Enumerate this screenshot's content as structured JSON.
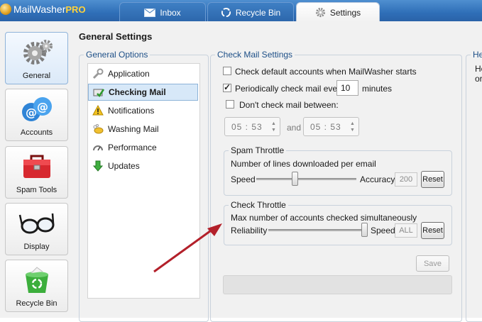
{
  "app": {
    "name": "MailWasher",
    "name_suffix": "PRO"
  },
  "tabs": [
    {
      "label": "Inbox",
      "icon": "envelope-icon"
    },
    {
      "label": "Recycle Bin",
      "icon": "recycle-icon"
    },
    {
      "label": "Settings",
      "icon": "gear-icon"
    }
  ],
  "nav": [
    {
      "label": "General",
      "icon": "gears-icon"
    },
    {
      "label": "Accounts",
      "icon": "at-sign-icon"
    },
    {
      "label": "Spam Tools",
      "icon": "toolbox-icon"
    },
    {
      "label": "Display",
      "icon": "glasses-icon"
    },
    {
      "label": "Recycle Bin",
      "icon": "recycle-bin-icon"
    }
  ],
  "page_title": "General Settings",
  "general_options": {
    "legend": "General Options",
    "items": [
      {
        "label": "Application",
        "icon": "wrench-icon"
      },
      {
        "label": "Checking Mail",
        "icon": "check-mail-icon"
      },
      {
        "label": "Notifications",
        "icon": "warning-icon"
      },
      {
        "label": "Washing Mail",
        "icon": "washing-icon"
      },
      {
        "label": "Performance",
        "icon": "gauge-icon"
      },
      {
        "label": "Updates",
        "icon": "down-arrow-icon"
      }
    ]
  },
  "check_mail": {
    "legend": "Check Mail Settings",
    "check_default": {
      "label": "Check default accounts when MailWasher starts",
      "checked": false
    },
    "periodic": {
      "label": "Periodically check mail every",
      "checked": true,
      "value": "10",
      "unit": "minutes"
    },
    "dont_check": {
      "label": "Don't check mail between:",
      "checked": false
    },
    "time_from": "05 : 53",
    "time_and": "and",
    "time_to": "05 : 53",
    "spam_throttle": {
      "legend": "Spam Throttle",
      "description": "Number of lines downloaded per email",
      "left_label": "Speed",
      "right_label": "Accuracy",
      "value": "200",
      "reset": "Reset",
      "level": 0.38
    },
    "check_throttle": {
      "legend": "Check Throttle",
      "description": "Max number of accounts checked simultaneously",
      "left_label": "Reliability",
      "right_label": "Speed",
      "value": "ALL",
      "reset": "Reset",
      "level": 1.0
    },
    "save": "Save"
  },
  "help": {
    "legend": "He",
    "line1": "He",
    "line2": "or"
  },
  "colors": {
    "accent": "#1d4f87",
    "arrow": "#b3202a",
    "tabbar": "#2f6fb8"
  }
}
